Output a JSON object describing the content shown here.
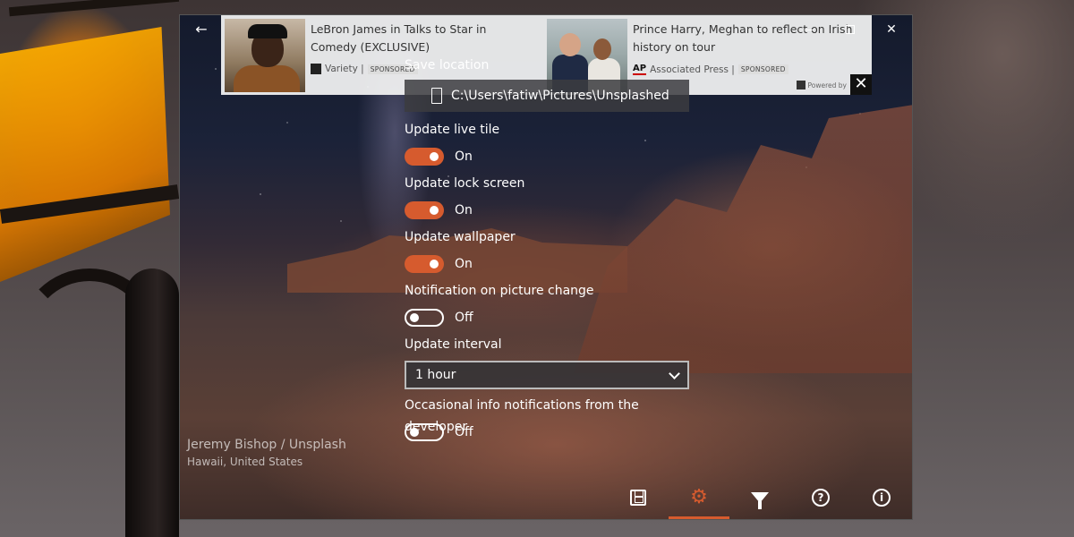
{
  "ad": {
    "left": {
      "title": "LeBron James in Talks to Star in Comedy (EXCLUSIVE)",
      "source": "Variety |",
      "sponsored": "SPONSORED"
    },
    "right": {
      "title": "Prince Harry, Meghan to reflect on Irish history on tour",
      "source": "Associated Press |",
      "source_logo": "AP",
      "sponsored": "SPONSORED"
    },
    "powered_by": "Powered by",
    "close_icon": "close-icon"
  },
  "window": {
    "back_icon": "back-arrow-icon",
    "controls": [
      "minimize-icon",
      "maximize-icon",
      "close-icon"
    ]
  },
  "settings": {
    "save_location": {
      "label": "Save location",
      "path": "C:\\Users\\fatiw\\Pictures\\Unsplashed"
    },
    "live_tile": {
      "label": "Update live tile",
      "state": "On",
      "on": true
    },
    "lock_screen": {
      "label": "Update lock screen",
      "state": "On",
      "on": true
    },
    "wallpaper": {
      "label": "Update wallpaper",
      "state": "On",
      "on": true
    },
    "notification": {
      "label": "Notification on picture change",
      "state": "Off",
      "on": false
    },
    "interval": {
      "label": "Update interval",
      "value": "1 hour"
    },
    "info_notifications": {
      "label": "Occasional info notifications from the developer",
      "state": "Off",
      "on": false
    }
  },
  "credit": {
    "author": "Jeremy Bishop / Unsplash",
    "location": "Hawaii, United States"
  },
  "bottom_bar": {
    "items": [
      "save-icon",
      "settings-gear-icon",
      "filter-icon",
      "help-icon",
      "info-icon"
    ],
    "active": "settings-gear-icon",
    "help_glyph": "?",
    "info_glyph": "i"
  },
  "colors": {
    "accent": "#d65b2e"
  }
}
